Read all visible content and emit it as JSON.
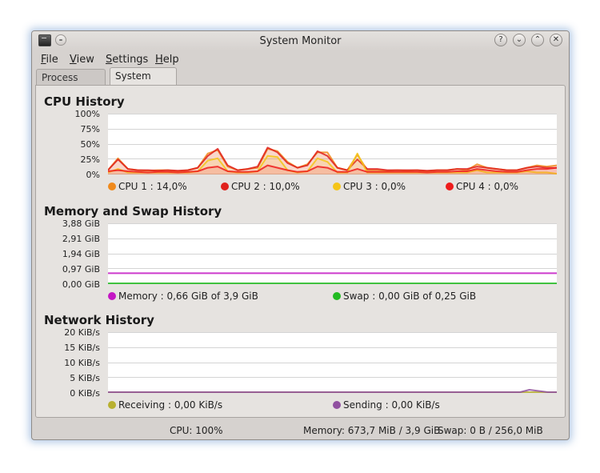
{
  "window": {
    "title": "System Monitor"
  },
  "menubar": {
    "items": [
      {
        "first": "F",
        "rest": "ile"
      },
      {
        "first": "V",
        "rest": "iew"
      },
      {
        "first": "S",
        "rest": "ettings"
      },
      {
        "first": "H",
        "rest": "elp"
      }
    ]
  },
  "tabs": [
    {
      "label": "Process Table",
      "active": false
    },
    {
      "label": "System Load",
      "active": true
    }
  ],
  "cpu": {
    "title": "CPU History",
    "yticks": [
      "100%",
      "75%",
      "50%",
      "25%",
      "0%"
    ],
    "legend": [
      {
        "label": "CPU 1 : 14,0%",
        "color": "#f08a1c"
      },
      {
        "label": "CPU 2 : 10,0%",
        "color": "#e0201c"
      },
      {
        "label": "CPU 3 : 0,0%",
        "color": "#f5c518"
      },
      {
        "label": "CPU 4 : 0,0%",
        "color": "#ee1c1c"
      }
    ]
  },
  "memory": {
    "title": "Memory and Swap History",
    "yticks": [
      "3,88 GiB",
      "2,91 GiB",
      "1,94 GiB",
      "0,97 GiB",
      "0,00 GiB"
    ],
    "legend": [
      {
        "label": "Memory : 0,66 GiB of 3,9 GiB",
        "color": "#c417c4"
      },
      {
        "label": "Swap : 0,00 GiB of 0,25 GiB",
        "color": "#22bb22"
      }
    ]
  },
  "network": {
    "title": "Network History",
    "yticks": [
      "20 KiB/s",
      "15 KiB/s",
      "10 KiB/s",
      "5 KiB/s",
      "0 KiB/s"
    ],
    "legend": [
      {
        "label": "Receiving : 0,00 KiB/s",
        "color": "#b8b030"
      },
      {
        "label": "Sending : 0,00 KiB/s",
        "color": "#9050a0"
      }
    ]
  },
  "statusbar": {
    "cpu": "CPU: 100%",
    "memory": "Memory: 673,7 MiB / 3,9 GiB",
    "swap": "Swap: 0 B / 256,0 MiB"
  },
  "chart_data": [
    {
      "type": "area",
      "title": "CPU History",
      "ylim": [
        0,
        100
      ],
      "grid": true,
      "series": [
        {
          "name": "CPU 1",
          "color": "#f08a1c",
          "values": [
            6,
            26,
            8,
            6,
            5,
            6,
            6,
            4,
            6,
            10,
            34,
            40,
            12,
            6,
            8,
            10,
            42,
            38,
            20,
            10,
            16,
            36,
            36,
            10,
            6,
            32,
            6,
            6,
            5,
            6,
            5,
            6,
            4,
            6,
            6,
            8,
            6,
            16,
            10,
            8,
            6,
            6,
            10,
            14,
            12,
            14
          ]
        },
        {
          "name": "CPU 2",
          "color": "#e0201c",
          "values": [
            6,
            24,
            8,
            6,
            6,
            5,
            6,
            5,
            6,
            10,
            30,
            42,
            14,
            6,
            8,
            12,
            44,
            36,
            18,
            10,
            14,
            38,
            30,
            10,
            6,
            24,
            8,
            8,
            6,
            6,
            6,
            6,
            5,
            6,
            6,
            8,
            8,
            12,
            10,
            8,
            6,
            6,
            10,
            12,
            10,
            10
          ]
        },
        {
          "name": "CPU 3",
          "color": "#f5c518",
          "values": [
            2,
            8,
            2,
            2,
            2,
            2,
            2,
            2,
            2,
            4,
            22,
            26,
            4,
            2,
            2,
            4,
            30,
            28,
            6,
            2,
            4,
            26,
            20,
            2,
            2,
            34,
            2,
            2,
            2,
            2,
            2,
            2,
            2,
            2,
            2,
            2,
            2,
            6,
            2,
            2,
            2,
            2,
            4,
            2,
            2,
            0
          ]
        },
        {
          "name": "CPU 4",
          "color": "#ee1c1c",
          "values": [
            4,
            6,
            4,
            3,
            2,
            3,
            3,
            2,
            3,
            4,
            10,
            12,
            4,
            3,
            3,
            4,
            14,
            10,
            6,
            3,
            4,
            12,
            10,
            3,
            3,
            8,
            3,
            3,
            3,
            3,
            3,
            3,
            2,
            3,
            3,
            4,
            4,
            8,
            6,
            4,
            3,
            3,
            6,
            8,
            8,
            10
          ]
        }
      ]
    },
    {
      "type": "line",
      "title": "Memory and Swap History",
      "ylim": [
        0,
        3.88
      ],
      "grid": true,
      "series": [
        {
          "name": "Memory",
          "color": "#c417c4",
          "values": [
            0.66,
            0.66,
            0.66,
            0.66,
            0.66,
            0.66,
            0.66,
            0.66,
            0.66,
            0.66,
            0.66,
            0.66,
            0.66,
            0.66,
            0.66,
            0.66,
            0.66,
            0.66,
            0.66,
            0.66,
            0.66,
            0.66,
            0.66,
            0.66,
            0.66,
            0.66,
            0.66,
            0.66,
            0.66,
            0.66,
            0.66,
            0.66,
            0.66,
            0.66,
            0.66,
            0.66,
            0.66,
            0.66,
            0.66,
            0.66,
            0.66,
            0.66,
            0.66,
            0.66,
            0.66,
            0.66
          ]
        },
        {
          "name": "Swap",
          "color": "#22bb22",
          "values": [
            0,
            0,
            0,
            0,
            0,
            0,
            0,
            0,
            0,
            0,
            0,
            0,
            0,
            0,
            0,
            0,
            0,
            0,
            0,
            0,
            0,
            0,
            0,
            0,
            0,
            0,
            0,
            0,
            0,
            0,
            0,
            0,
            0,
            0,
            0,
            0,
            0,
            0,
            0,
            0,
            0,
            0,
            0,
            0,
            0,
            0
          ]
        }
      ]
    },
    {
      "type": "line",
      "title": "Network History",
      "ylim": [
        0,
        20
      ],
      "grid": true,
      "series": [
        {
          "name": "Receiving",
          "color": "#b8b030",
          "values": [
            0,
            0,
            0,
            0,
            0,
            0,
            0,
            0,
            0,
            0,
            0,
            0,
            0,
            0,
            0,
            0,
            0,
            0,
            0,
            0,
            0,
            0,
            0,
            0,
            0,
            0,
            0,
            0,
            0,
            0,
            0,
            0,
            0,
            0,
            0,
            0,
            0,
            0,
            0,
            0,
            0,
            0,
            0,
            0,
            0,
            0
          ]
        },
        {
          "name": "Sending",
          "color": "#9050a0",
          "values": [
            0,
            0,
            0,
            0,
            0,
            0,
            0,
            0,
            0,
            0,
            0,
            0,
            0,
            0,
            0,
            0,
            0,
            0,
            0,
            0,
            0,
            0,
            0,
            0,
            0,
            0,
            0,
            0,
            0,
            0,
            0,
            0,
            0,
            0,
            0,
            0,
            0,
            0,
            0,
            0,
            0,
            0,
            0,
            0,
            0,
            0,
            0.8,
            0.4,
            0,
            0
          ]
        }
      ]
    }
  ]
}
